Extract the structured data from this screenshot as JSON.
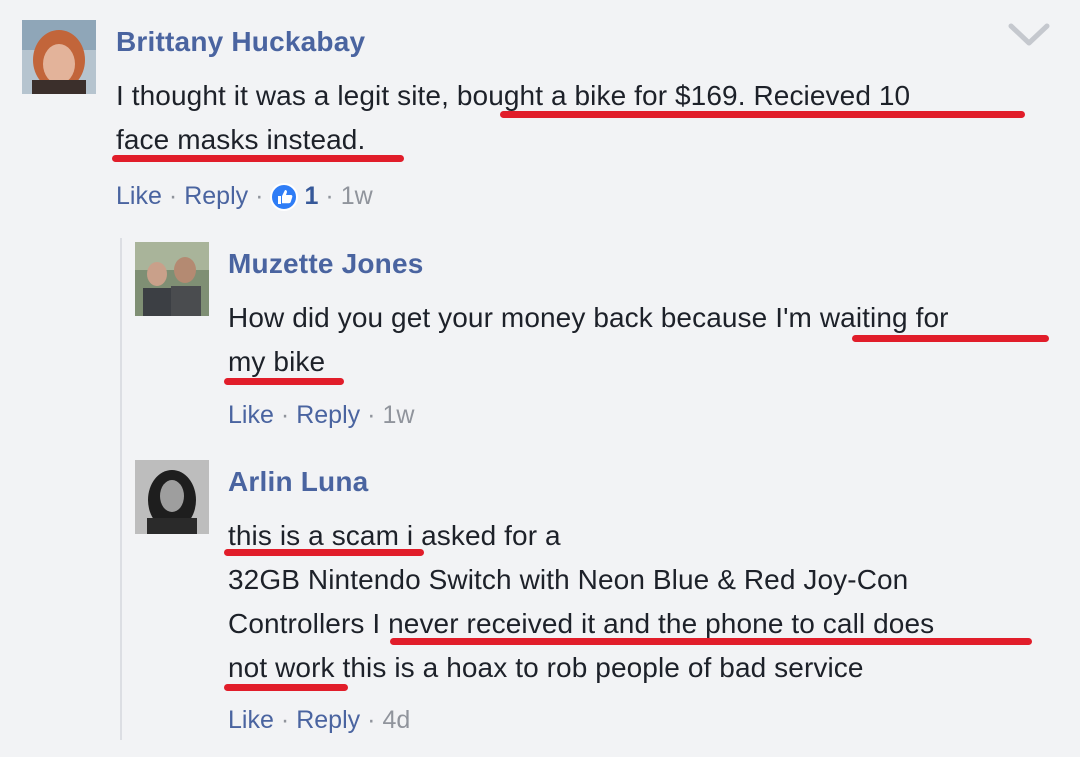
{
  "comments": [
    {
      "author": "Brittany Huckabay",
      "lines": [
        {
          "a": "I thought it was a legit site, ",
          "b": "bought a bike for $169. Recieved 10"
        },
        {
          "a": "face masks instead."
        }
      ],
      "actions": {
        "like": "Like",
        "reply": "Reply",
        "reactions": "1",
        "time": "1w"
      }
    },
    {
      "author": "Muzette Jones",
      "lines": [
        {
          "a": "How did you get your money back because ",
          "b": "I'm waiting for"
        },
        {
          "a": "my bike"
        }
      ],
      "actions": {
        "like": "Like",
        "reply": "Reply",
        "time": "1w"
      }
    },
    {
      "author": "Arlin Luna",
      "lines": [
        {
          "a": "this is a scam",
          "b": " i asked for a"
        },
        {
          "a": "32GB Nintendo Switch with Neon Blue & Red Joy-Con"
        },
        {
          "a": "Controllers ",
          "b": "I never received it and the phone to call does"
        },
        {
          "a": "not work",
          "b": " this is a hoax to rob people of bad service"
        }
      ],
      "actions": {
        "like": "Like",
        "reply": "Reply",
        "time": "4d"
      }
    }
  ],
  "icons": {
    "options": "chevron-down-icon",
    "reaction": "like-reaction-icon"
  },
  "colors": {
    "background": "#f2f3f5",
    "author": "#4a64a0",
    "text": "#1d2129",
    "meta": "#90949c",
    "underline": "#e11d2a",
    "like_badge": "#2f7df6"
  }
}
